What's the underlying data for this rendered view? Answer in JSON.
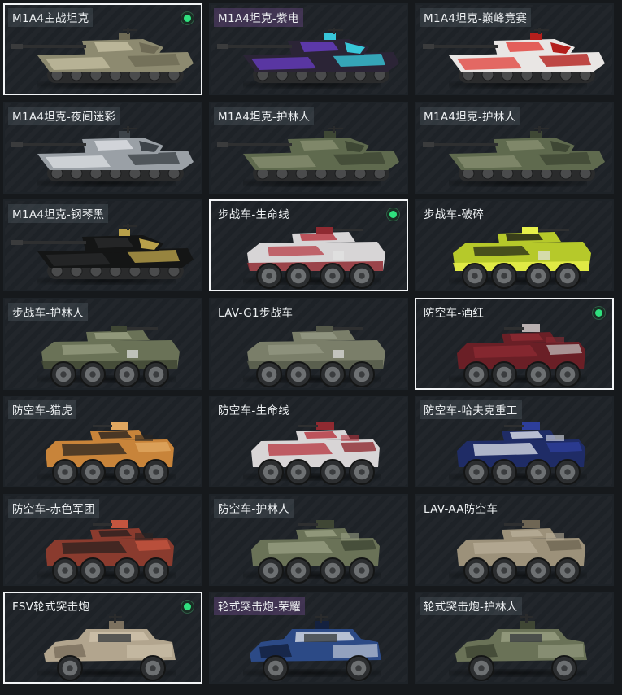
{
  "tiles": [
    {
      "label": "M1A4主战坦克",
      "selected": true,
      "equipped": true,
      "type": "tank",
      "tint": "gray",
      "body": "#8d8a70",
      "accent": "#c9c3a5",
      "detail": "#6e6a55"
    },
    {
      "label": "M1A4坦克-紫电",
      "selected": false,
      "equipped": false,
      "type": "tank",
      "tint": "purple",
      "body": "#2b2436",
      "accent": "#6d3fd0",
      "detail": "#38c6d9"
    },
    {
      "label": "M1A4坦克-巅峰竞赛",
      "selected": false,
      "equipped": false,
      "type": "tank",
      "tint": "gray",
      "body": "#e9e6e4",
      "accent": "#e0322c",
      "detail": "#b31f1c"
    },
    {
      "label": "M1A4坦克-夜间迷彩",
      "selected": false,
      "equipped": false,
      "type": "tank",
      "tint": "gray",
      "body": "#9aa0a6",
      "accent": "#e3e6e9",
      "detail": "#3d4349"
    },
    {
      "label": "M1A4坦克-护林人",
      "selected": false,
      "equipped": false,
      "type": "tank",
      "tint": "gray",
      "body": "#5f6a4e",
      "accent": "#8a9173",
      "detail": "#3e4734"
    },
    {
      "label": "M1A4坦克-护林人",
      "selected": false,
      "equipped": false,
      "type": "tank",
      "tint": "gray",
      "body": "#5f6a4e",
      "accent": "#8a9173",
      "detail": "#3e4734"
    },
    {
      "label": "M1A4坦克-钢琴黑",
      "selected": false,
      "equipped": false,
      "type": "tank",
      "tint": "gray",
      "body": "#141515",
      "accent": "#2a2b2c",
      "detail": "#b8a04a"
    },
    {
      "label": "步战车-生命线",
      "selected": true,
      "equipped": true,
      "type": "ifv",
      "tint": "none",
      "body": "#d7d5d6",
      "accent": "#b5323c",
      "detail": "#8f2a31"
    },
    {
      "label": "步战车-破碎",
      "selected": false,
      "equipped": false,
      "type": "ifv",
      "tint": "none",
      "body": "#b6c92a",
      "accent": "#1a1c17",
      "detail": "#e7f04a"
    },
    {
      "label": "步战车-护林人",
      "selected": false,
      "equipped": false,
      "type": "ifv",
      "tint": "gray",
      "body": "#6a7257",
      "accent": "#9aa083",
      "detail": "#3f4634"
    },
    {
      "label": "LAV-G1步战车",
      "selected": false,
      "equipped": false,
      "type": "ifv",
      "tint": "none",
      "body": "#7a7e69",
      "accent": "#959a84",
      "detail": "#55594a"
    },
    {
      "label": "防空车-酒红",
      "selected": true,
      "equipped": true,
      "type": "aa",
      "tint": "none",
      "body": "#6a1f26",
      "accent": "#8e2b33",
      "detail": "#b9b0b0"
    },
    {
      "label": "防空车-猎虎",
      "selected": false,
      "equipped": false,
      "type": "aa",
      "tint": "gray",
      "body": "#c8843a",
      "accent": "#2a2420",
      "detail": "#e0a760"
    },
    {
      "label": "防空车-生命线",
      "selected": false,
      "equipped": false,
      "type": "aa",
      "tint": "none",
      "body": "#d8d5d6",
      "accent": "#b5323c",
      "detail": "#8f2a31"
    },
    {
      "label": "防空车-哈夫克重工",
      "selected": false,
      "equipped": false,
      "type": "aa",
      "tint": "gray",
      "body": "#1f2c66",
      "accent": "#dfe3ec",
      "detail": "#2d3e9a"
    },
    {
      "label": "防空车-赤色军团",
      "selected": false,
      "equipped": false,
      "type": "aa",
      "tint": "gray",
      "body": "#8a3b2e",
      "accent": "#2b211f",
      "detail": "#c4553f"
    },
    {
      "label": "防空车-护林人",
      "selected": false,
      "equipped": false,
      "type": "aa",
      "tint": "gray",
      "body": "#6a7257",
      "accent": "#9aa083",
      "detail": "#3f4634"
    },
    {
      "label": "LAV-AA防空车",
      "selected": false,
      "equipped": false,
      "type": "aa",
      "tint": "none",
      "body": "#9c917a",
      "accent": "#b8ae98",
      "detail": "#6f6654"
    },
    {
      "label": "FSV轮式突击炮",
      "selected": true,
      "equipped": true,
      "type": "fsv",
      "tint": "none",
      "body": "#b2a58e",
      "accent": "#cfc3ac",
      "detail": "#7c715f"
    },
    {
      "label": "轮式突击炮-荣耀",
      "selected": false,
      "equipped": false,
      "type": "fsv",
      "tint": "purple",
      "body": "#2c4a86",
      "accent": "#d9dde6",
      "detail": "#14213f"
    },
    {
      "label": "轮式突击炮-护林人",
      "selected": false,
      "equipped": false,
      "type": "fsv",
      "tint": "gray",
      "body": "#6a7257",
      "accent": "#9aa083",
      "detail": "#3f4634"
    }
  ]
}
